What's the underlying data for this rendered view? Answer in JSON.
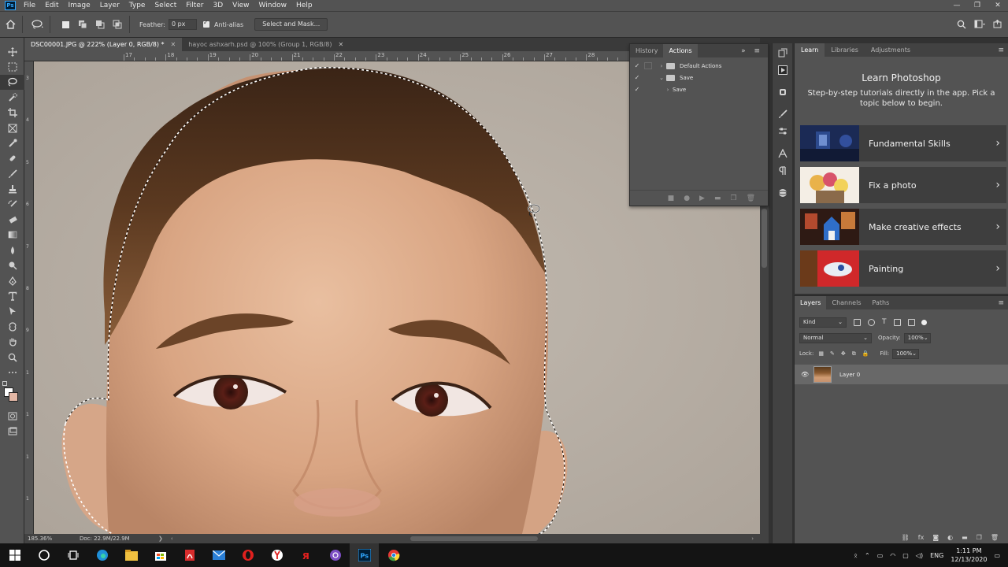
{
  "menubar": {
    "app_logo": "Ps",
    "items": [
      "File",
      "Edit",
      "Image",
      "Layer",
      "Type",
      "Select",
      "Filter",
      "3D",
      "View",
      "Window",
      "Help"
    ],
    "window_buttons": [
      "—",
      "❐",
      "✕"
    ]
  },
  "options": {
    "feather_label": "Feather:",
    "feather_value": "0 px",
    "antialias_label": "Anti-alias",
    "select_mask_label": "Select and Mask..."
  },
  "tabs": [
    {
      "label": "DSC00001.JPG @ 222% (Layer 0, RGB/8) *",
      "active": true
    },
    {
      "label": "hayoc ashxarh.psd @ 100% (Group 1, RGB/8)",
      "active": false
    }
  ],
  "ruler_top": [
    "17",
    "18",
    "19",
    "20",
    "21",
    "22",
    "23",
    "24",
    "25",
    "26",
    "27",
    "28"
  ],
  "ruler_left": [
    "3",
    "4",
    "5",
    "6",
    "7",
    "8",
    "9",
    "1",
    "1",
    "1",
    "1"
  ],
  "status": {
    "zoom": "185.36%",
    "doc": "Doc: 22.9M/22.9M"
  },
  "actions_panel": {
    "tabs": [
      "History",
      "Actions"
    ],
    "active_tab": "Actions",
    "rows": [
      {
        "label": "Default Actions",
        "level": 0,
        "type": "set"
      },
      {
        "label": "Save",
        "level": 0,
        "type": "set-open"
      },
      {
        "label": "Save",
        "level": 1,
        "type": "action"
      }
    ]
  },
  "learn_panel": {
    "tabs": [
      "Learn",
      "Libraries",
      "Adjustments"
    ],
    "active_tab": "Learn",
    "title": "Learn Photoshop",
    "description": "Step-by-step tutorials directly in the app. Pick a topic below to begin.",
    "cards": [
      {
        "label": "Fundamental Skills"
      },
      {
        "label": "Fix a photo"
      },
      {
        "label": "Make creative effects"
      },
      {
        "label": "Painting"
      }
    ]
  },
  "layers_panel": {
    "tabs": [
      "Layers",
      "Channels",
      "Paths"
    ],
    "active_tab": "Layers",
    "filter_label": "Kind",
    "blend_mode": "Normal",
    "opacity_label": "Opacity:",
    "opacity_value": "100%",
    "lock_label": "Lock:",
    "fill_label": "Fill:",
    "fill_value": "100%",
    "layers": [
      {
        "name": "Layer 0"
      }
    ]
  },
  "taskbar": {
    "lang": "ENG",
    "time": "1:11 PM",
    "date": "12/13/2020"
  },
  "colors": {
    "accent": "#31a8ff",
    "canvas_bg": "#bbb2a8",
    "panel": "#535353"
  }
}
